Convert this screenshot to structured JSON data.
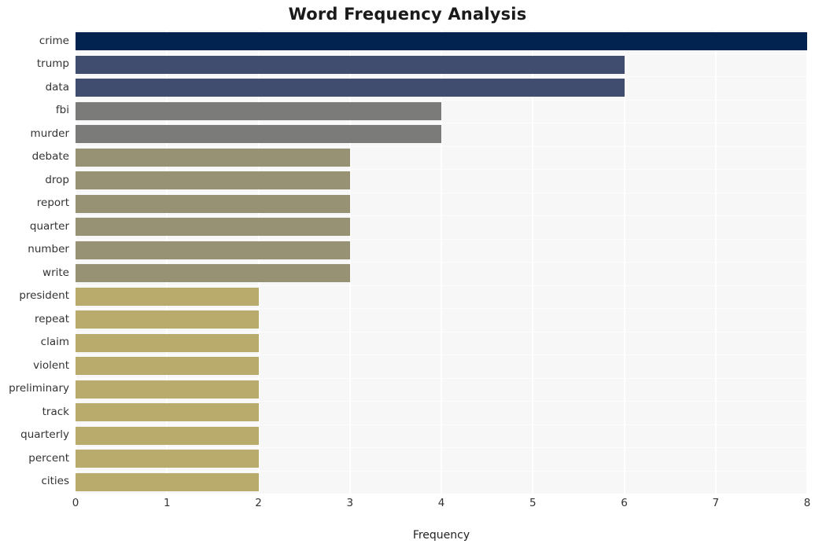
{
  "chart_data": {
    "type": "bar",
    "orientation": "horizontal",
    "title": "Word Frequency Analysis",
    "xlabel": "Frequency",
    "ylabel": "",
    "xlim": [
      0,
      8
    ],
    "xticks": [
      0,
      1,
      2,
      3,
      4,
      5,
      6,
      7,
      8
    ],
    "xtick_labels": [
      "0",
      "1",
      "2",
      "3",
      "4",
      "5",
      "6",
      "7",
      "8"
    ],
    "grid": true,
    "grid_axis": "both",
    "legend": false,
    "plot_background": "#f7f7f7",
    "figure_background": "#ffffff",
    "gridline_color": "#ffffff",
    "categories": [
      "crime",
      "trump",
      "data",
      "fbi",
      "murder",
      "debate",
      "drop",
      "report",
      "quarter",
      "number",
      "write",
      "president",
      "repeat",
      "claim",
      "violent",
      "preliminary",
      "track",
      "quarterly",
      "percent",
      "cities"
    ],
    "values": [
      8,
      6,
      6,
      4,
      4,
      3,
      3,
      3,
      3,
      3,
      3,
      2,
      2,
      2,
      2,
      2,
      2,
      2,
      2,
      2
    ],
    "bar_colors": [
      "#022350",
      "#414d6e",
      "#414d6e",
      "#7b7b79",
      "#7b7b79",
      "#989274",
      "#989274",
      "#989274",
      "#989274",
      "#989274",
      "#989274",
      "#b8ab6c",
      "#b8ab6c",
      "#b8ab6c",
      "#b8ab6c",
      "#b8ab6c",
      "#b8ab6c",
      "#b8ab6c",
      "#b8ab6c",
      "#b8ab6c"
    ]
  }
}
